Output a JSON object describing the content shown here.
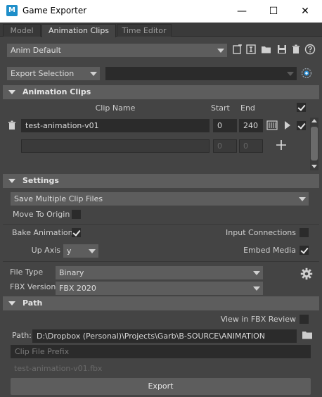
{
  "window": {
    "title": "Game Exporter",
    "app_letter": "M",
    "minimize": "—",
    "maximize": "☐",
    "close": "✕"
  },
  "tabs": [
    {
      "label": "Model"
    },
    {
      "label": "Animation Clips"
    },
    {
      "label": "Time Editor"
    }
  ],
  "preset": {
    "value": "Anim Default"
  },
  "export_mode": {
    "value": "Export Selection",
    "set_value": ""
  },
  "animation_clips": {
    "header": "Animation Clips",
    "col_clip_name": "Clip Name",
    "col_start": "Start",
    "col_end": "End",
    "rows": [
      {
        "name": "test-animation-v01",
        "start": "0",
        "end": "240"
      }
    ],
    "new_row": {
      "start": "0",
      "end": "0"
    }
  },
  "settings": {
    "header": "Settings",
    "clip_mode": "Save Multiple Clip Files",
    "move_to_origin": "Move To Origin",
    "bake_animation": "Bake Animation",
    "input_connections": "Input Connections",
    "up_axis_label": "Up Axis",
    "up_axis_value": "y",
    "embed_media": "Embed Media",
    "file_type_label": "File Type",
    "file_type_value": "Binary",
    "fbx_version_label": "FBX Version",
    "fbx_version_value": "FBX 2020"
  },
  "path": {
    "header": "Path",
    "view_in_fbx_review": "View in FBX Review",
    "path_label": "Path:",
    "path_value": "D:\\Dropbox (Personal)\\Projects\\Garb\\B-SOURCE\\ANIMATION",
    "prefix_placeholder": "Clip File Prefix",
    "preview_filename": "test-animation-v01.fbx"
  },
  "export_button": "Export",
  "colors": {
    "panel": "#444444",
    "field": "#2b2b2b",
    "header": "#5d5d5d",
    "accent": "#1e8ec9"
  }
}
